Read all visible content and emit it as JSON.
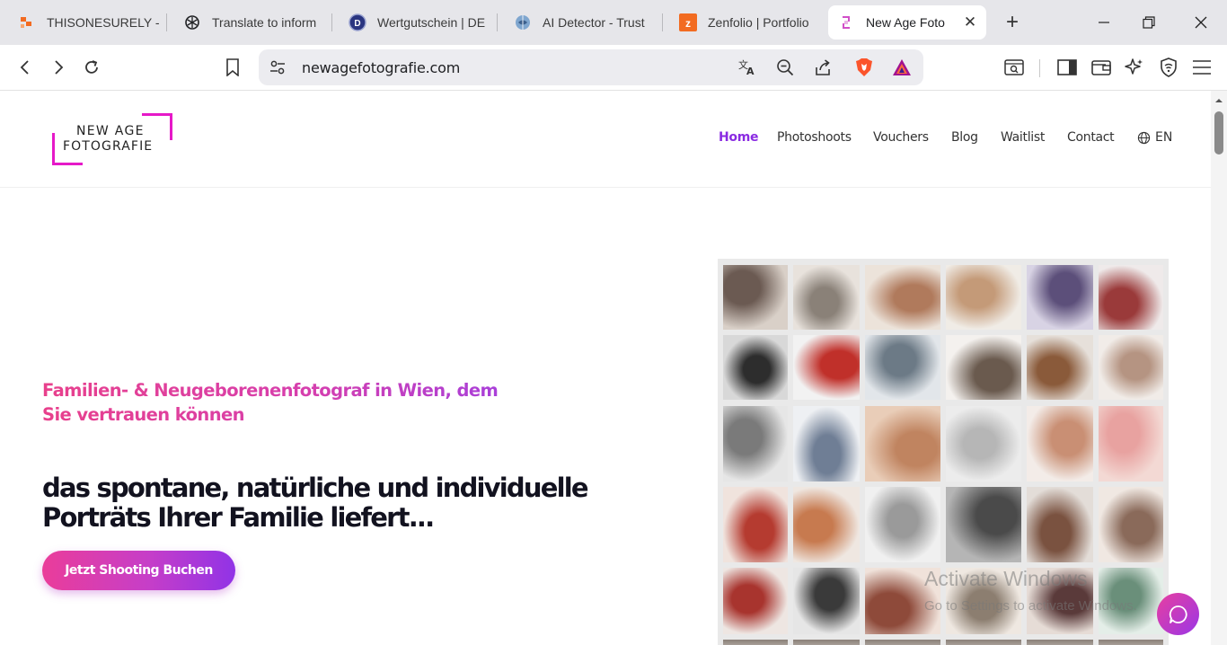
{
  "browser": {
    "tabs": [
      {
        "title": "THISONESURELY -",
        "favicon": "zenfolio-orange-icon",
        "color": "#f26b21"
      },
      {
        "title": "Translate to inform",
        "favicon": "chatgpt-icon",
        "color": "#202124"
      },
      {
        "title": "Wertgutschein | DE",
        "favicon": "d-letter-icon",
        "color": "#2a3580"
      },
      {
        "title": "AI Detector - Trust",
        "favicon": "brain-globe-icon",
        "color": "#4a6fa5"
      },
      {
        "title": "Zenfolio | Portfolio",
        "favicon": "zenfolio-z-icon",
        "color": "#f26b21"
      },
      {
        "title": "New Age Foto",
        "favicon": "newage-favicon",
        "color": "#d14fc8",
        "active": true
      }
    ],
    "new_tab_icon": "plus-icon",
    "url": "newagefotografie.com"
  },
  "site": {
    "logo": {
      "line1": "NEW AGE",
      "line2": "FOTOGRAFIE",
      "accent": "#e619c8"
    },
    "nav": [
      {
        "label": "Home",
        "active": true
      },
      {
        "label": "Photoshoots"
      },
      {
        "label": "Vouchers"
      },
      {
        "label": "Blog"
      },
      {
        "label": "Waitlist"
      },
      {
        "label": "Contact"
      }
    ],
    "language": "EN",
    "hero": {
      "subtitle": "Familien- & Neugeborenenfotograf in Wien, dem Sie vertrauen können",
      "title": "das spontane, natürliche und individuelle Porträts Ihrer Familie liefert...",
      "cta": "Jetzt Shooting Buchen"
    },
    "watermark": {
      "line1": "Activate Windows",
      "line2": "Go to Settings to activate Windows."
    },
    "collage": {
      "columns": 6,
      "rows": 5,
      "photos": [
        [
          "#6b5a52",
          "#d9d0c8"
        ],
        [
          "#8a8178",
          "#e8e2dc"
        ],
        [
          "#b07a5c",
          "#ece3da"
        ],
        [
          "#c49a78",
          "#f0ece6"
        ],
        [
          "#5c4f7a",
          "#d8d3e4"
        ],
        [
          "#9a3a3a",
          "#efeaea"
        ],
        [
          "#2d2d2d",
          "#d8d8d8"
        ],
        [
          "#c0302a",
          "#f2f2f2"
        ],
        [
          "#6c7a86",
          "#e2e6ea"
        ],
        [
          "#6a5a4e",
          "#f4f1ee"
        ],
        [
          "#8a5a3a",
          "#e6e0da"
        ],
        [
          "#b59482",
          "#f1ece8"
        ],
        [
          "#7a7a7a",
          "#e6e6e6"
        ],
        [
          "#6f7e95",
          "#eef0f3"
        ],
        [
          "#c08460",
          "#e9cdb8"
        ],
        [
          "#b6b6b6",
          "#ececec"
        ],
        [
          "#c98f74",
          "#f3ece8"
        ],
        [
          "#e8a2a0",
          "#f3d9d4"
        ],
        [
          "#b53b30",
          "#f0e3dd"
        ],
        [
          "#c77a4f",
          "#efe7e1"
        ],
        [
          "#9a9a9a",
          "#f0f0f0"
        ],
        [
          "#4a4a4a",
          "#b5b5b5"
        ],
        [
          "#7a5240",
          "#e3ddd8"
        ],
        [
          "#8a6a5a",
          "#f0e8e2"
        ],
        [
          "#a8342e",
          "#eee6e2"
        ],
        [
          "#3a3a3a",
          "#e6e6e6"
        ],
        [
          "#8e4a3a",
          "#f0e2da"
        ],
        [
          "#8c7e70",
          "#efe8e1"
        ],
        [
          "#5a3a3a",
          "#e6dcd6"
        ],
        [
          "#6a8f7a",
          "#e4eee8"
        ]
      ]
    }
  }
}
